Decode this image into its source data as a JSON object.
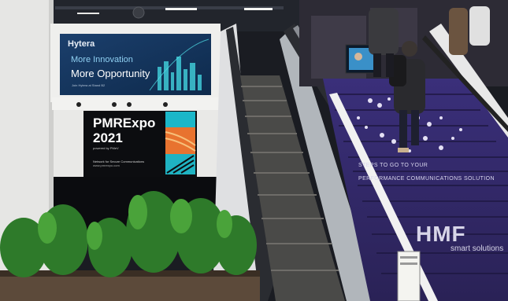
{
  "banner": {
    "brand": "Hytera",
    "line1": "More Innovation",
    "line2": "More Opportunity",
    "line3": "Join Hytera at Stand B2"
  },
  "expo": {
    "title": "PMRExpo",
    "year": "2021",
    "powered": "powered by PMeV",
    "network": "Network for Secure Communications",
    "url": "www.pmrexpo.com"
  },
  "stairs": {
    "text1": "STEPS TO GO TO YOUR",
    "text2": "PERFORMANCE COMMUNICATIONS SOLUTION",
    "logo": "HMF",
    "tagline": "smart solutions"
  }
}
